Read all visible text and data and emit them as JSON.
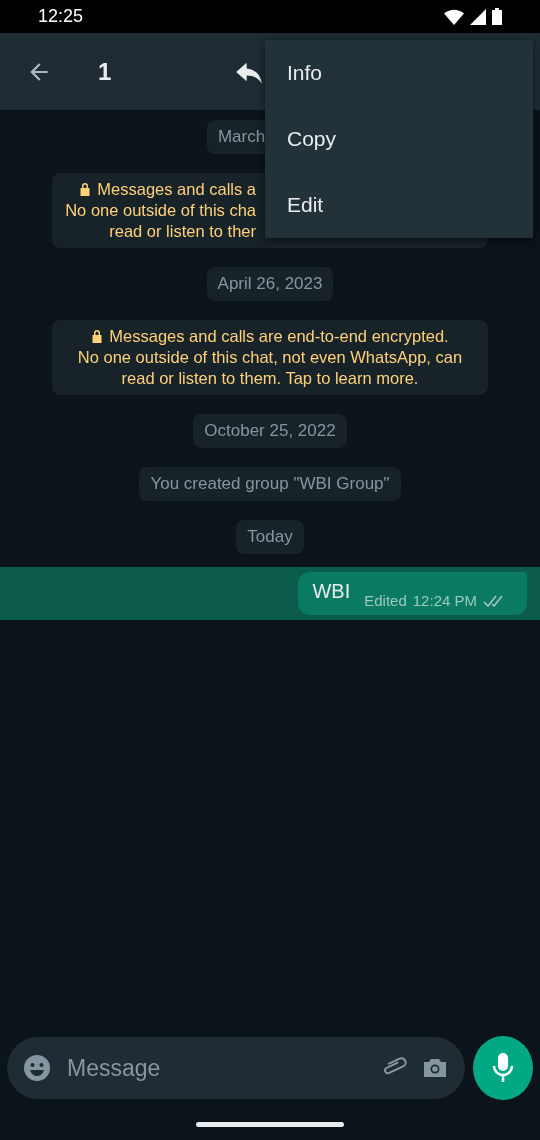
{
  "status_bar": {
    "time": "12:25"
  },
  "selection_bar": {
    "count": "1"
  },
  "messages": [
    {
      "kind": "date",
      "text": "March"
    },
    {
      "kind": "notice",
      "cut": true,
      "lines": [
        "Messages and calls a",
        "No one outside of this cha",
        "read or listen to ther"
      ]
    },
    {
      "kind": "date",
      "text": "April 26, 2023"
    },
    {
      "kind": "notice",
      "cut": false,
      "lines": [
        "Messages and calls are end-to-end encrypted.",
        "No one outside of this chat, not even WhatsApp, can",
        "read or listen to them. Tap to learn more."
      ]
    },
    {
      "kind": "date",
      "text": "October 25, 2022"
    },
    {
      "kind": "system",
      "text": "You created group \"WBI Group\""
    },
    {
      "kind": "date",
      "text": "Today"
    },
    {
      "kind": "outgoing",
      "text": "WBI",
      "edited_label": "Edited",
      "time": "12:24 PM",
      "selected": true,
      "delivered": true
    }
  ],
  "menu": {
    "items": [
      {
        "label": "Info"
      },
      {
        "label": "Copy"
      },
      {
        "label": "Edit"
      }
    ]
  },
  "composer": {
    "placeholder": "Message"
  }
}
